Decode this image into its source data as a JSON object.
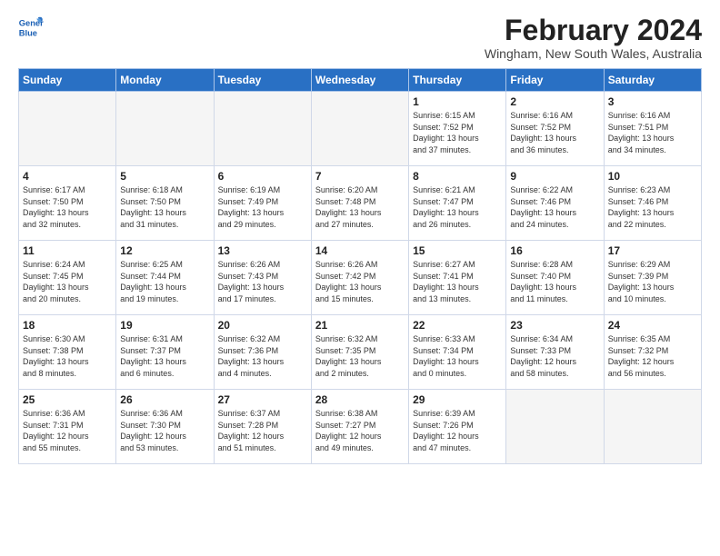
{
  "logo": {
    "line1": "General",
    "line2": "Blue"
  },
  "title": "February 2024",
  "location": "Wingham, New South Wales, Australia",
  "days_of_week": [
    "Sunday",
    "Monday",
    "Tuesday",
    "Wednesday",
    "Thursday",
    "Friday",
    "Saturday"
  ],
  "weeks": [
    [
      {
        "day": "",
        "detail": ""
      },
      {
        "day": "",
        "detail": ""
      },
      {
        "day": "",
        "detail": ""
      },
      {
        "day": "",
        "detail": ""
      },
      {
        "day": "1",
        "detail": "Sunrise: 6:15 AM\nSunset: 7:52 PM\nDaylight: 13 hours\nand 37 minutes."
      },
      {
        "day": "2",
        "detail": "Sunrise: 6:16 AM\nSunset: 7:52 PM\nDaylight: 13 hours\nand 36 minutes."
      },
      {
        "day": "3",
        "detail": "Sunrise: 6:16 AM\nSunset: 7:51 PM\nDaylight: 13 hours\nand 34 minutes."
      }
    ],
    [
      {
        "day": "4",
        "detail": "Sunrise: 6:17 AM\nSunset: 7:50 PM\nDaylight: 13 hours\nand 32 minutes."
      },
      {
        "day": "5",
        "detail": "Sunrise: 6:18 AM\nSunset: 7:50 PM\nDaylight: 13 hours\nand 31 minutes."
      },
      {
        "day": "6",
        "detail": "Sunrise: 6:19 AM\nSunset: 7:49 PM\nDaylight: 13 hours\nand 29 minutes."
      },
      {
        "day": "7",
        "detail": "Sunrise: 6:20 AM\nSunset: 7:48 PM\nDaylight: 13 hours\nand 27 minutes."
      },
      {
        "day": "8",
        "detail": "Sunrise: 6:21 AM\nSunset: 7:47 PM\nDaylight: 13 hours\nand 26 minutes."
      },
      {
        "day": "9",
        "detail": "Sunrise: 6:22 AM\nSunset: 7:46 PM\nDaylight: 13 hours\nand 24 minutes."
      },
      {
        "day": "10",
        "detail": "Sunrise: 6:23 AM\nSunset: 7:46 PM\nDaylight: 13 hours\nand 22 minutes."
      }
    ],
    [
      {
        "day": "11",
        "detail": "Sunrise: 6:24 AM\nSunset: 7:45 PM\nDaylight: 13 hours\nand 20 minutes."
      },
      {
        "day": "12",
        "detail": "Sunrise: 6:25 AM\nSunset: 7:44 PM\nDaylight: 13 hours\nand 19 minutes."
      },
      {
        "day": "13",
        "detail": "Sunrise: 6:26 AM\nSunset: 7:43 PM\nDaylight: 13 hours\nand 17 minutes."
      },
      {
        "day": "14",
        "detail": "Sunrise: 6:26 AM\nSunset: 7:42 PM\nDaylight: 13 hours\nand 15 minutes."
      },
      {
        "day": "15",
        "detail": "Sunrise: 6:27 AM\nSunset: 7:41 PM\nDaylight: 13 hours\nand 13 minutes."
      },
      {
        "day": "16",
        "detail": "Sunrise: 6:28 AM\nSunset: 7:40 PM\nDaylight: 13 hours\nand 11 minutes."
      },
      {
        "day": "17",
        "detail": "Sunrise: 6:29 AM\nSunset: 7:39 PM\nDaylight: 13 hours\nand 10 minutes."
      }
    ],
    [
      {
        "day": "18",
        "detail": "Sunrise: 6:30 AM\nSunset: 7:38 PM\nDaylight: 13 hours\nand 8 minutes."
      },
      {
        "day": "19",
        "detail": "Sunrise: 6:31 AM\nSunset: 7:37 PM\nDaylight: 13 hours\nand 6 minutes."
      },
      {
        "day": "20",
        "detail": "Sunrise: 6:32 AM\nSunset: 7:36 PM\nDaylight: 13 hours\nand 4 minutes."
      },
      {
        "day": "21",
        "detail": "Sunrise: 6:32 AM\nSunset: 7:35 PM\nDaylight: 13 hours\nand 2 minutes."
      },
      {
        "day": "22",
        "detail": "Sunrise: 6:33 AM\nSunset: 7:34 PM\nDaylight: 13 hours\nand 0 minutes."
      },
      {
        "day": "23",
        "detail": "Sunrise: 6:34 AM\nSunset: 7:33 PM\nDaylight: 12 hours\nand 58 minutes."
      },
      {
        "day": "24",
        "detail": "Sunrise: 6:35 AM\nSunset: 7:32 PM\nDaylight: 12 hours\nand 56 minutes."
      }
    ],
    [
      {
        "day": "25",
        "detail": "Sunrise: 6:36 AM\nSunset: 7:31 PM\nDaylight: 12 hours\nand 55 minutes."
      },
      {
        "day": "26",
        "detail": "Sunrise: 6:36 AM\nSunset: 7:30 PM\nDaylight: 12 hours\nand 53 minutes."
      },
      {
        "day": "27",
        "detail": "Sunrise: 6:37 AM\nSunset: 7:28 PM\nDaylight: 12 hours\nand 51 minutes."
      },
      {
        "day": "28",
        "detail": "Sunrise: 6:38 AM\nSunset: 7:27 PM\nDaylight: 12 hours\nand 49 minutes."
      },
      {
        "day": "29",
        "detail": "Sunrise: 6:39 AM\nSunset: 7:26 PM\nDaylight: 12 hours\nand 47 minutes."
      },
      {
        "day": "",
        "detail": ""
      },
      {
        "day": "",
        "detail": ""
      }
    ]
  ]
}
